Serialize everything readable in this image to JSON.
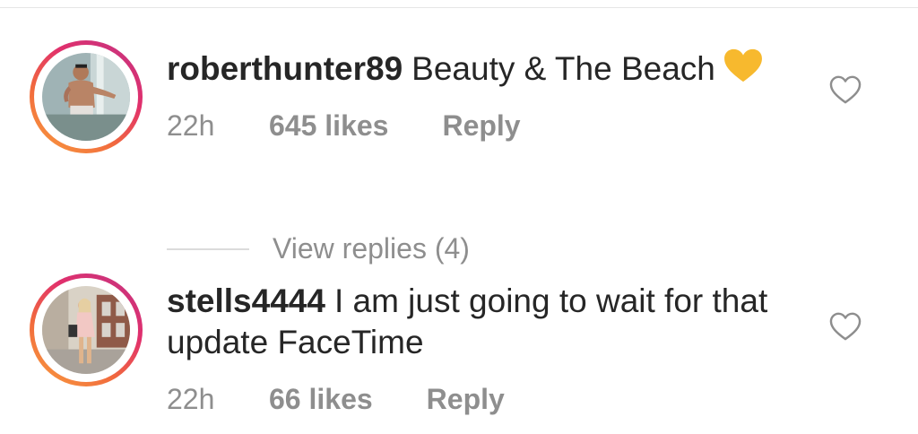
{
  "comments": [
    {
      "username": "roberthunter89",
      "text": "Beauty & The Beach",
      "emoji": "yellow-heart-icon",
      "time": "22h",
      "likes": "645 likes",
      "reply_label": "Reply"
    },
    {
      "username": "stells4444",
      "text": "I am just going to wait for that update FaceTime",
      "time": "22h",
      "likes": "66 likes",
      "reply_label": "Reply"
    }
  ],
  "view_replies_label": "View replies (4)",
  "colors": {
    "text": "#262626",
    "meta": "#8e8e8e",
    "emoji_heart": "#f7b92e",
    "ring_start": "#f9a03f",
    "ring_end": "#c13584"
  }
}
